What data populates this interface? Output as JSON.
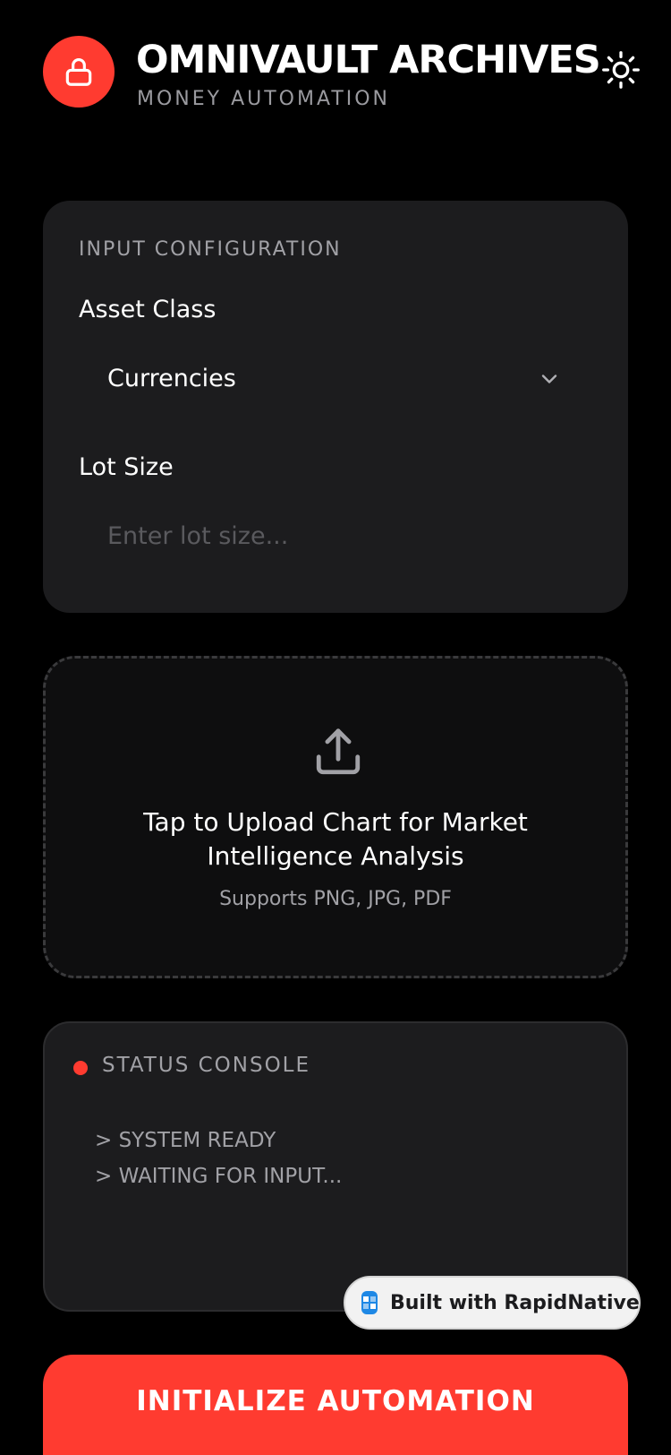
{
  "header": {
    "title": "OMNIVAULT ARCHIVES",
    "subtitle": "MONEY AUTOMATION",
    "logo_icon": "lock-icon",
    "theme_icon": "sun-icon"
  },
  "config": {
    "section_label": "INPUT CONFIGURATION",
    "asset_class_label": "Asset Class",
    "asset_class_value": "Currencies",
    "lot_size_label": "Lot Size",
    "lot_size_placeholder": "Enter lot size...",
    "lot_size_value": ""
  },
  "upload": {
    "icon": "upload-icon",
    "title": "Tap to Upload Chart for Market Intelligence Analysis",
    "hint": "Supports PNG, JPG, PDF"
  },
  "console": {
    "title": "STATUS CONSOLE",
    "lines": [
      "> SYSTEM READY",
      "> WAITING FOR INPUT..."
    ]
  },
  "badge": {
    "label": "Built with RapidNative"
  },
  "actions": {
    "primary_label": "INITIALIZE AUTOMATION"
  },
  "colors": {
    "accent": "#ff3b30",
    "background": "#000000",
    "card": "#1c1c1e",
    "muted_text": "#a1a1a6"
  }
}
